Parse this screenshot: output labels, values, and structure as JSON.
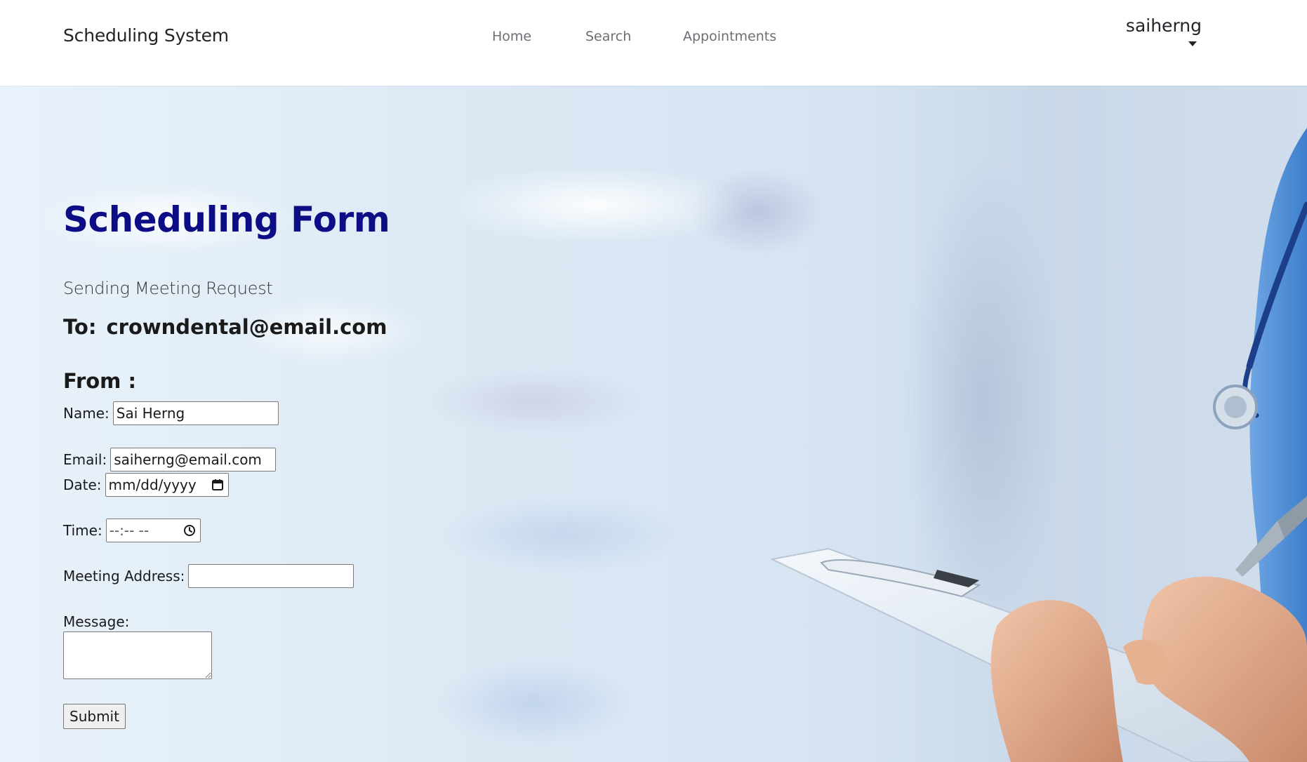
{
  "navbar": {
    "brand": "Scheduling System",
    "links": [
      "Home",
      "Search",
      "Appointments"
    ],
    "user": "saiherng"
  },
  "page": {
    "title": "Scheduling Form",
    "subtitle": "Sending Meeting Request",
    "to_label": "To:",
    "to_email": "crowndental@email.com",
    "from_heading": "From :"
  },
  "form": {
    "name_label": "Name:",
    "name_value": "Sai Herng",
    "email_label": "Email:",
    "email_value": "saiherng@email.com",
    "date_label": "Date:",
    "date_placeholder": "mm/dd/yyyy",
    "time_label": "Time:",
    "time_placeholder": "--:-- --",
    "address_label": "Meeting Address:",
    "address_value": "",
    "message_label": "Message:",
    "message_value": "",
    "submit_label": "Submit"
  },
  "colors": {
    "title": "#0d0d85",
    "nav_link": "#6b6f73",
    "scrubs": "#4f8fd6"
  },
  "icons": [
    "calendar-icon",
    "clock-icon",
    "caret-down-icon",
    "resize-handle-icon"
  ]
}
